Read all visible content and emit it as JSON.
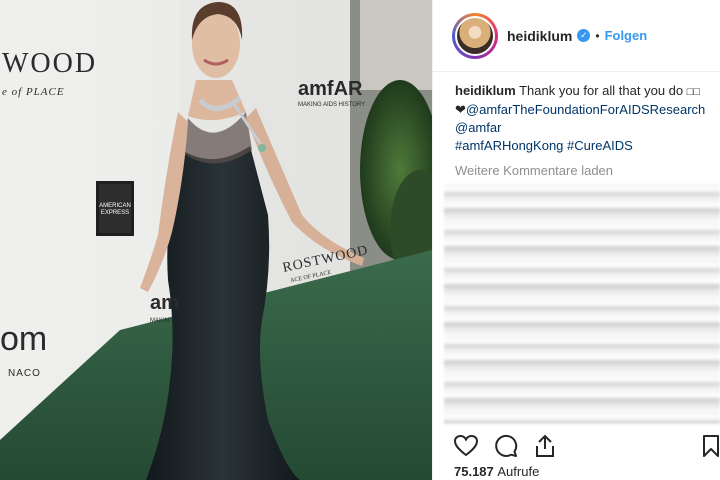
{
  "post": {
    "username": "heidiklum",
    "follow_label": "Folgen",
    "separator": "•",
    "verified_mark": "✓",
    "caption": {
      "username": "heidiklum",
      "text": "Thank you for all that you do",
      "heart": "❤",
      "tags": [
        "@amfarTheFoundationForAIDSResearch",
        "@amfar",
        "#amfARHongKong",
        "#CureAIDS"
      ]
    },
    "load_more_comments": "Weitere Kommentare laden",
    "view_count": "75.187",
    "view_label": "Aufrufe"
  },
  "media": {
    "wall_texts": [
      "WOOD",
      "e of PLACE",
      "amfAR",
      "MAKING AIDS HISTORY",
      "AMERICAN EXPRESS",
      "ROSTWOOD",
      "ACE OF PLACE",
      "om",
      "NACO",
      "am",
      "MAKIN"
    ]
  },
  "icons": [
    "heart-icon",
    "comment-icon",
    "share-icon",
    "bookmark-icon",
    "verified-badge-icon"
  ],
  "colors": {
    "accent": "#3897f0",
    "link": "#003569",
    "muted": "#8e8e8e",
    "carpet": "#2f5a3f",
    "dress": "#1b2226"
  }
}
